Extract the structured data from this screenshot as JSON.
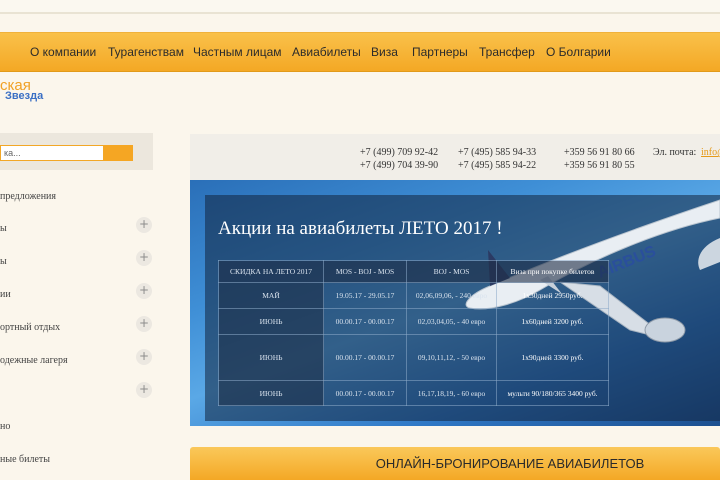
{
  "nav": {
    "items": [
      "О компании",
      "Турагенствам",
      "Частным лицам",
      "Авиабилеты",
      "Виза",
      "Партнеры",
      "Трансфер",
      "О Болгарии"
    ]
  },
  "logo": {
    "line1": "ская",
    "line2": "Звезда"
  },
  "search": {
    "placeholder": "ка..."
  },
  "sidebar": {
    "items": [
      "предложения",
      "ы",
      "ы",
      "ии",
      "ортный отдых",
      "одежные лагеря",
      "",
      "но",
      "ные билеты"
    ]
  },
  "contacts": {
    "phones_col1": [
      "+7 (499) 709 92-42",
      "+7 (499) 704 39-90"
    ],
    "phones_col2": [
      "+7 (495) 585 94-33",
      "+7 (495) 585 94-22"
    ],
    "phones_col3": [
      "+359 56 91 80 66",
      "+359 56 91 80 55"
    ],
    "email_label": "Эл. почта:",
    "email_value": "info@"
  },
  "banner": {
    "title": "Акции на авиабилеты ЛЕТО 2017 !",
    "plane_text": "AIRBUS",
    "table": {
      "headers": [
        "СКИДКА НА ЛЕТО 2017",
        "MOS - BOJ - MOS",
        "BOJ - MOS",
        "Виза при покупке билетов"
      ],
      "rows": [
        [
          "МАЙ",
          "19.05.17 - 29.05.17",
          "02,06,09,06, - 240 евро",
          "1x30дней     2950руб."
        ],
        [
          "ИЮНЬ",
          "00.00.17 - 00.00.17",
          "02,03,04,05, - 40 евро",
          "1x60дней   3200 руб."
        ],
        [
          "ИЮНЬ",
          "00.00.17 - 00.00.17",
          "09,10,11,12, - 50 евро",
          "1x90дней   3300 руб."
        ],
        [
          "ИЮНЬ",
          "00.00.17 - 00.00.17",
          "16,17,18,19, - 60 евро",
          "мульти 90/180/365  3400 руб."
        ]
      ]
    }
  },
  "booking": {
    "label": "ОНЛАЙН-БРОНИРОВАНИЕ АВИАБИЛЕТОВ"
  },
  "colors": {
    "accent": "#f4a825",
    "link": "#e59a1a",
    "banner_blue": "#3f8fd6"
  }
}
